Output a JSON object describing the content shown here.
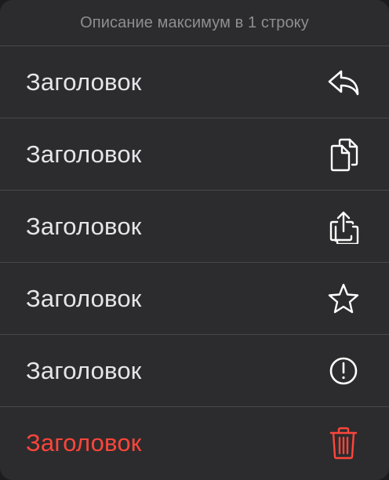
{
  "menu": {
    "description": "Описание максимум в 1 строку",
    "items": [
      {
        "label": "Заголовок",
        "icon": "reply-icon"
      },
      {
        "label": "Заголовок",
        "icon": "copy-icon"
      },
      {
        "label": "Заголовок",
        "icon": "share-icon"
      },
      {
        "label": "Заголовок",
        "icon": "star-icon"
      },
      {
        "label": "Заголовок",
        "icon": "exclamation-circle-icon"
      },
      {
        "label": "Заголовок",
        "icon": "trash-icon",
        "destructive": true
      }
    ]
  },
  "colors": {
    "background": "#2c2c2e",
    "separator": "#48484a",
    "text": "#e5e5ea",
    "secondary_text": "#8e8e93",
    "destructive": "#ff453a"
  }
}
